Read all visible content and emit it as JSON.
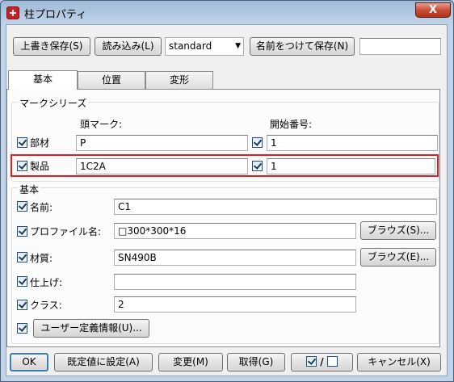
{
  "window": {
    "title": "柱プロパティ",
    "close_glyph": "X"
  },
  "toolbar": {
    "overwrite_save": "上書き保存(S)",
    "load": "読み込み(L)",
    "preset_value": "standard",
    "save_as": "名前をつけて保存(N)",
    "save_as_name": ""
  },
  "tabs": [
    "基本",
    "位置",
    "変形"
  ],
  "mark_series": {
    "title": "マークシリーズ",
    "header_prefix": "頭マーク:",
    "header_start": "開始番号:",
    "rows": [
      {
        "label": "部材",
        "prefix": "P",
        "start": "1"
      },
      {
        "label": "製品",
        "prefix": "1C2A",
        "start": "1"
      }
    ]
  },
  "basic": {
    "title": "基本",
    "name_label": "名前:",
    "name_value": "C1",
    "profile_label": "プロファイル名:",
    "profile_value": "□300*300*16",
    "profile_browse": "ブラウズ(S)...",
    "material_label": "材質:",
    "material_value": "SN490B",
    "material_browse": "ブラウズ(E)...",
    "finish_label": "仕上げ:",
    "finish_value": "",
    "class_label": "クラス:",
    "class_value": "2",
    "user_defined": "ユーザー定義情報(U)..."
  },
  "footer": {
    "ok": "OK",
    "set_default": "既定値に設定(A)",
    "modify": "変更(M)",
    "get": "取得(G)",
    "toggle_sep": "/",
    "cancel": "キャンセル(X)"
  }
}
